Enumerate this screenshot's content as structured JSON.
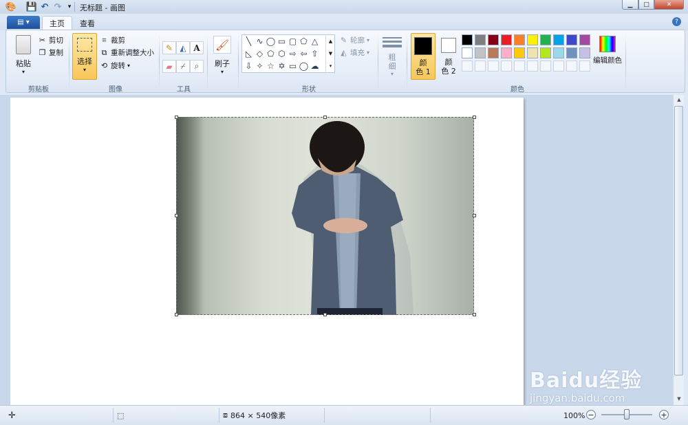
{
  "window": {
    "title": "无标题 - 画图"
  },
  "tabs": [
    {
      "label": "主页"
    },
    {
      "label": "查看"
    }
  ],
  "clipboard": {
    "paste": "粘贴",
    "cut": "剪切",
    "copy": "复制",
    "group": "剪贴板"
  },
  "image": {
    "select": "选择",
    "crop": "裁剪",
    "resize": "重新调整大小",
    "rotate": "旋转",
    "group": "图像"
  },
  "tools": {
    "group": "工具"
  },
  "brushes": {
    "label": "刷子"
  },
  "shapes": {
    "outline": "轮廓",
    "fill": "填充",
    "group": "形状"
  },
  "size": {
    "label_top": "粗",
    "label_bottom": "细"
  },
  "colors": {
    "color1_top": "颜",
    "color1_bottom": "色 1",
    "color2_top": "颜",
    "color2_bottom": "色 2",
    "edit": "编辑颜色",
    "group": "颜色",
    "color1_value": "#000000",
    "color2_value": "#ffffff",
    "palette_row1": [
      "#000000",
      "#7f7f7f",
      "#880015",
      "#ed1c24",
      "#ff7f27",
      "#fff200",
      "#22b14c",
      "#00a2e8",
      "#3f48cc",
      "#a349a4"
    ],
    "palette_row2": [
      "#ffffff",
      "#c3c3c3",
      "#b97a57",
      "#ffaec9",
      "#ffc90e",
      "#efe4b0",
      "#b5e61d",
      "#99d9ea",
      "#7092be",
      "#c8bfe7"
    ]
  },
  "status": {
    "dimensions": "864 × 540像素",
    "zoom": "100%"
  },
  "watermark": {
    "brand": "Baidu经验",
    "url": "jingyan.baidu.com"
  }
}
